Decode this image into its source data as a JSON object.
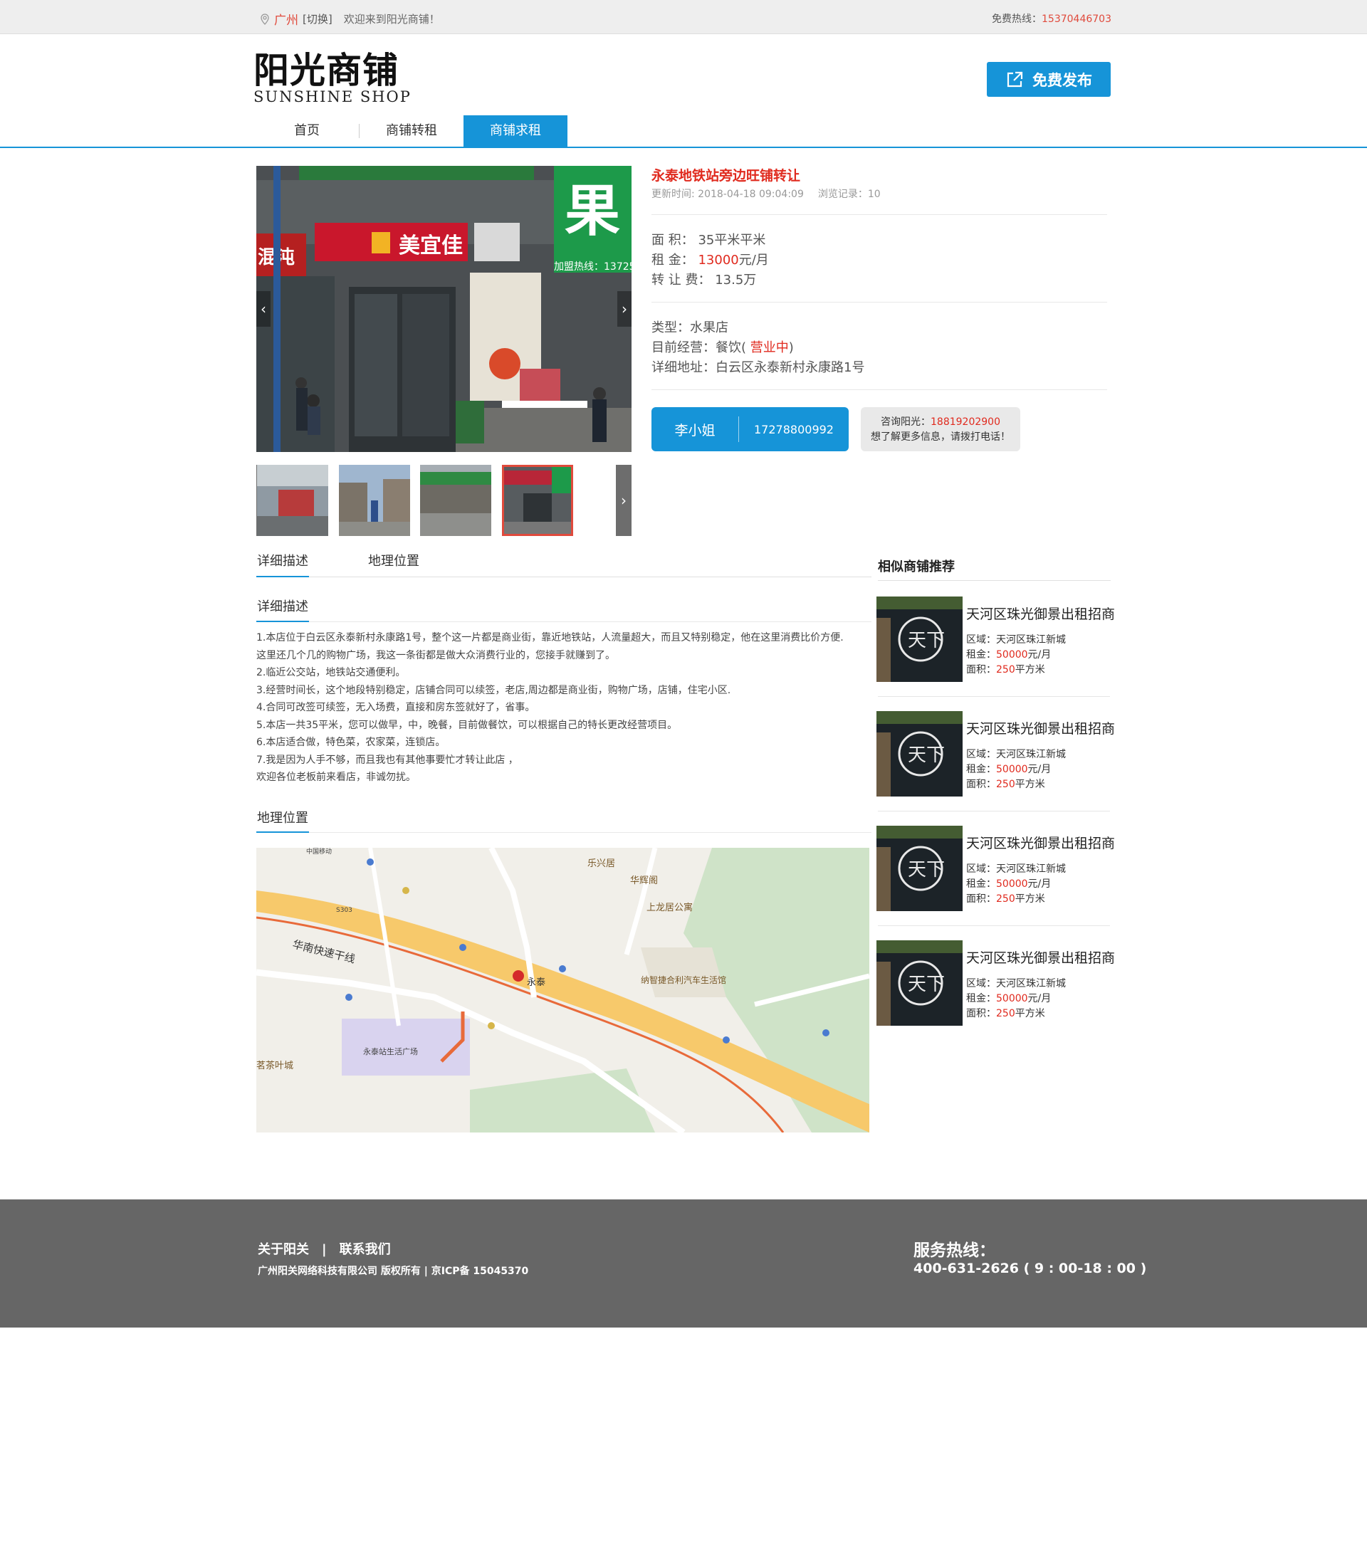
{
  "topbar": {
    "city": "广州",
    "switch_label": "[切换]",
    "welcome": "欢迎来到阳光商铺！",
    "hotline_label": "免费热线：",
    "hotline_number": "15370446703"
  },
  "logo": {
    "cn": "阳光商铺",
    "en": "SUNSHINE SHOP"
  },
  "publish_button": "免费发布",
  "nav": [
    {
      "label": "首页"
    },
    {
      "label": "商铺转租"
    },
    {
      "label": "商铺求租"
    }
  ],
  "shop": {
    "title": "永泰地铁站旁边旺铺转让",
    "updated": "更新时间: 2018-04-18 09:04:09",
    "views": "浏览记录：10",
    "area_label": "面 积：",
    "area_value": "35平米平米",
    "rent_label": "租 金：",
    "rent_value": "13000",
    "rent_unit": "元/月",
    "fee_label": "转 让 费：",
    "fee_value": "13.5万",
    "type": "类型：水果店",
    "business_prefix": "目前经营：餐饮(",
    "business_status": "营业中",
    "business_suffix": ")",
    "address": "详细地址：白云区永泰新村永康路1号",
    "photo_text": {
      "fruit": "果",
      "store": "美宜佳",
      "hotline": "加盟热线：13725",
      "noodle": "混沌"
    }
  },
  "contact": {
    "name": "李小姐",
    "phone": "17278800992",
    "consult_label": "咨询阳光：",
    "consult_phone": "18819202900",
    "consult_note": "想了解更多信息，请拨打电话！"
  },
  "tabs": [
    {
      "label": "详细描述"
    },
    {
      "label": "地理位置"
    }
  ],
  "description": {
    "title": "详细描述",
    "lines": [
      "1.本店位于白云区永泰新村永康路1号，整个这一片都是商业街，靠近地铁站，人流量超大，而且又特别稳定，他在这里消费比价方便.",
      "这里还几个几的购物广场，我这一条街都是做大众消费行业的，您接手就赚到了。",
      "2.临近公交站，地铁站交通便利。",
      "3.经营时间长，这个地段特别稳定，店铺合同可以续签，老店,周边都是商业街，购物广场，店铺，住宅小区.",
      "4.合同可改签可续签，无入场费，直接和房东签就好了，省事。",
      "5.本店一共35平米，您可以做早，中，晚餐，目前做餐饮，可以根据自己的特长更改经营项目。",
      "6.本店适合做，特色菜，农家菜，连锁店。",
      "7.我是因为人手不够，而且我也有其他事要忙才转让此店 ，",
      "欢迎各位老板前来看店，非诚勿扰。"
    ]
  },
  "location": {
    "title": "地理位置",
    "map_labels": {
      "road_main": "华南快速干线",
      "station": "永泰",
      "plaza": "永泰站生活广场",
      "market": "纳智捷合利汽车生活馆",
      "apartment": "上龙居公寓",
      "pavilion": "华辉阁",
      "lexing": "乐兴居",
      "tea": "茗茶叶城",
      "s303": "S303",
      "mobile": "中国移动"
    }
  },
  "sidebar": {
    "title": "相似商铺推荐",
    "items": [
      {
        "title": "天河区珠光御景出租招商",
        "district_label": "区域：",
        "district": "天河区珠江新城",
        "rent_label": "租金：",
        "rent": "50000",
        "rent_unit": "元/月",
        "area_label": "面积：",
        "area": "250",
        "area_unit": "平方米"
      },
      {
        "title": "天河区珠光御景出租招商",
        "district_label": "区域：",
        "district": "天河区珠江新城",
        "rent_label": "租金：",
        "rent": "50000",
        "rent_unit": "元/月",
        "area_label": "面积：",
        "area": "250",
        "area_unit": "平方米"
      },
      {
        "title": "天河区珠光御景出租招商",
        "district_label": "区域：",
        "district": "天河区珠江新城",
        "rent_label": "租金：",
        "rent": "50000",
        "rent_unit": "元/月",
        "area_label": "面积：",
        "area": "250",
        "area_unit": "平方米"
      },
      {
        "title": "天河区珠光御景出租招商",
        "district_label": "区域：",
        "district": "天河区珠江新城",
        "rent_label": "租金：",
        "rent": "50000",
        "rent_unit": "元/月",
        "area_label": "面积：",
        "area": "250",
        "area_unit": "平方米"
      }
    ],
    "sign_text": "天下"
  },
  "footer": {
    "about": "关于阳关",
    "pipe": "|",
    "contact": "联系我们",
    "copyright": "广州阳关网络科技有限公司 版权所有 | 京ICP备 15045370",
    "hotline_title": "服务热线：",
    "hotline": "400-631-2626 ( 9 : 00-18 : 00 )"
  },
  "colors": {
    "accent": "#1694d8",
    "red": "#e02a1e",
    "footer_bg": "#666666",
    "topbar_bg": "#eeeeee"
  },
  "icons": [
    "location-pin-icon",
    "external-link-icon",
    "chevron-left-icon",
    "chevron-right-icon"
  ]
}
